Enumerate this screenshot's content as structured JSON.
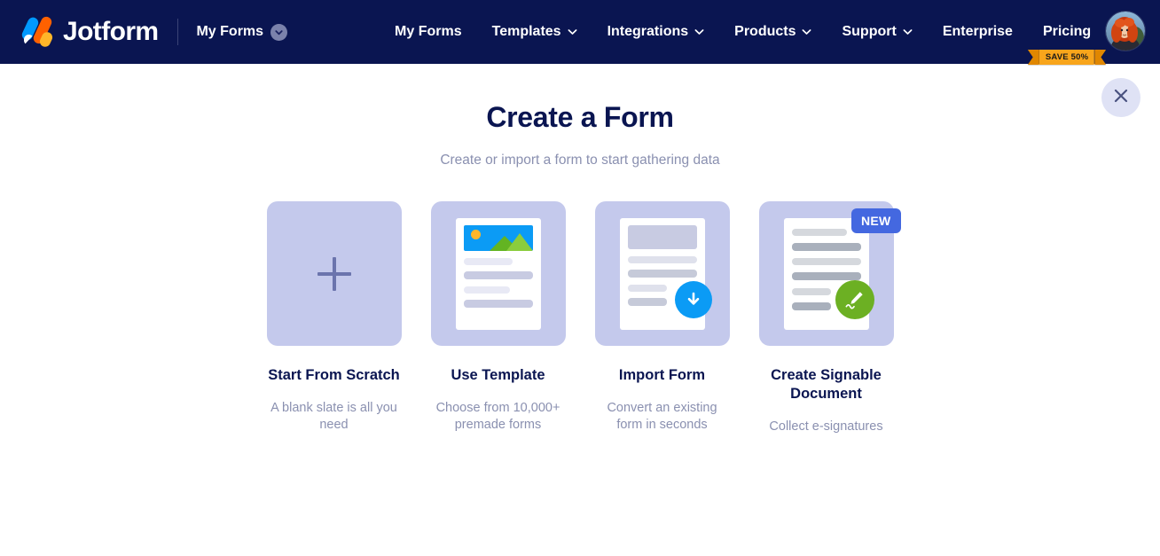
{
  "header": {
    "brand_name": "Jotform",
    "logo_icon": "jotform-logo-icon",
    "workspace_label": "My Forms",
    "workspace_chevron_icon": "chevron-down-icon",
    "nav": [
      {
        "label": "My Forms",
        "has_caret": false
      },
      {
        "label": "Templates",
        "has_caret": true
      },
      {
        "label": "Integrations",
        "has_caret": true
      },
      {
        "label": "Products",
        "has_caret": true
      },
      {
        "label": "Support",
        "has_caret": true
      },
      {
        "label": "Enterprise",
        "has_caret": false
      },
      {
        "label": "Pricing",
        "has_caret": false
      }
    ],
    "promo_ribbon": "SAVE 50%",
    "avatar_icon": "user-avatar",
    "background_color": "#0a1551"
  },
  "close_button": {
    "icon": "close-icon",
    "background_color": "#dfe2f5"
  },
  "main": {
    "title": "Create a Form",
    "subtitle": "Create or import a form to start gathering data",
    "cards": [
      {
        "title": "Start From Scratch",
        "description": "A blank slate is all you need",
        "icon": "plus-icon",
        "badge": null
      },
      {
        "title": "Use Template",
        "description": "Choose from 10,000+ premade forms",
        "icon": "template-document-icon",
        "badge": null
      },
      {
        "title": "Import Form",
        "description": "Convert an existing form in seconds",
        "icon": "import-download-icon",
        "badge": null
      },
      {
        "title": "Create Signable Document",
        "description": "Collect e-signatures",
        "icon": "signature-pen-icon",
        "badge": "NEW"
      }
    ]
  },
  "colors": {
    "header_navy": "#0a1551",
    "card_lavender": "#c4c9ec",
    "accent_blue": "#0b9bf5",
    "accent_green": "#6cb023",
    "badge_blue": "#4468e0",
    "ribbon_amber": "#f8a51b",
    "muted_text": "#8a90b0"
  }
}
